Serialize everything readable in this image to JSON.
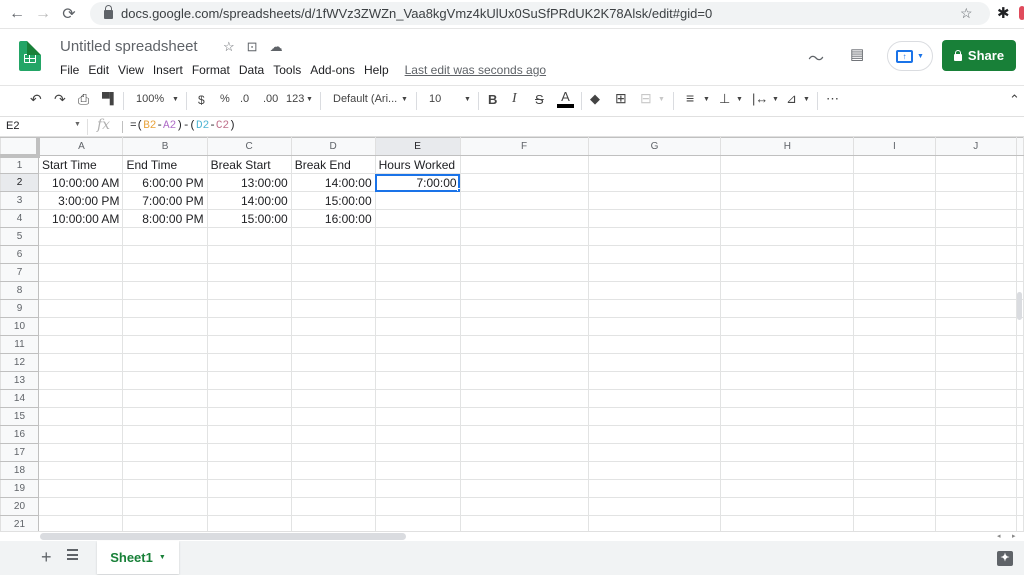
{
  "browser": {
    "url": "docs.google.com/spreadsheets/d/1fWVz3ZWZn_Vaa8kgVmz4kUlUx0SuSfPRdUK2K78Alsk/edit#gid=0",
    "icons": {
      "back": "←",
      "forward": "→",
      "reload": "⟳",
      "star": "☆",
      "extensions": "✱"
    }
  },
  "app": {
    "title": "Untitled spreadsheet",
    "title_icons": {
      "star": "☆",
      "move": "⊡",
      "cloud": "☁"
    },
    "menu": [
      "File",
      "Edit",
      "View",
      "Insert",
      "Format",
      "Data",
      "Tools",
      "Add-ons",
      "Help"
    ],
    "last_edit": "Last edit was seconds ago",
    "share_label": "Share",
    "accent": "#188038",
    "selection_color": "#1a73e8"
  },
  "toolbar": {
    "undo": "↶",
    "redo": "↷",
    "print": "⎙",
    "paint_format": "🖌",
    "zoom": "100%",
    "currency": "$",
    "percent": "%",
    "decrease_decimal": ".0",
    "increase_decimal": ".00",
    "more_formats": "123",
    "font": "Default (Ari...",
    "font_size": "10",
    "bold": "B",
    "italic": "I",
    "strikethrough": "S",
    "text_color": "A",
    "more": "⋯",
    "collapse": "⌃"
  },
  "formula_bar": {
    "cell_ref": "E2",
    "fx": "fx",
    "formula_parts": [
      {
        "text": "=(",
        "color": "#202124"
      },
      {
        "text": "B2",
        "color": "#e8a33b"
      },
      {
        "text": "-",
        "color": "#202124"
      },
      {
        "text": "A2",
        "color": "#b06dc8"
      },
      {
        "text": ")-(",
        "color": "#202124"
      },
      {
        "text": "D2",
        "color": "#4fb5d4"
      },
      {
        "text": "-",
        "color": "#202124"
      },
      {
        "text": "C2",
        "color": "#c0708a"
      },
      {
        "text": ")",
        "color": "#202124"
      }
    ]
  },
  "sheet": {
    "columns": [
      "A",
      "B",
      "C",
      "D",
      "E",
      "F",
      "G",
      "H",
      "I",
      "J"
    ],
    "selected_column": "E",
    "selected_row": 2,
    "row_count": 21,
    "rows": [
      [
        "Start Time",
        "End Time",
        "Break Start",
        "Break End",
        "Hours Worked"
      ],
      [
        "10:00:00 AM",
        "6:00:00 PM",
        "13:00:00",
        "14:00:00",
        "7:00:00"
      ],
      [
        "3:00:00 PM",
        "7:00:00 PM",
        "14:00:00",
        "15:00:00",
        ""
      ],
      [
        "10:00:00 AM",
        "8:00:00 PM",
        "15:00:00",
        "16:00:00",
        ""
      ]
    ]
  },
  "bottom": {
    "add_sheet": "+",
    "sheet_tabs": [
      {
        "label": "Sheet1",
        "active": true
      }
    ]
  }
}
